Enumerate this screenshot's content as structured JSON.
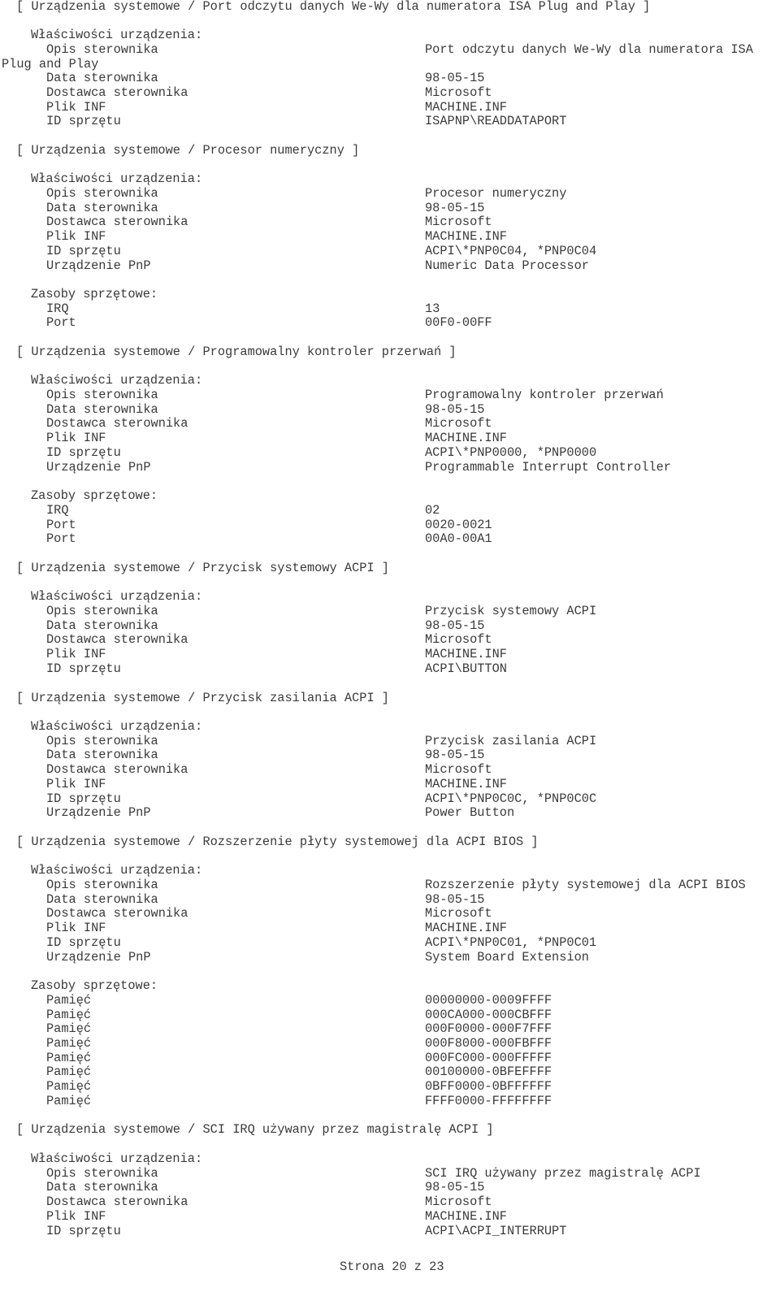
{
  "document": {
    "sections": [
      {
        "title": "[ Urządzenia systemowe / Port odczytu danych We-Wy dla numeratora ISA Plug and Play ]",
        "properties_heading": "Właściwości urządzenia:",
        "properties": [
          {
            "label": "Opis sterownika",
            "value": "Port odczytu danych We-Wy dla numeratora ISA",
            "continuation": "Plug and Play"
          },
          {
            "label": "Data sterownika",
            "value": "98-05-15"
          },
          {
            "label": "Dostawca sterownika",
            "value": "Microsoft"
          },
          {
            "label": "Plik INF",
            "value": "MACHINE.INF"
          },
          {
            "label": "ID sprzętu",
            "value": "ISAPNP\\READDATAPORT"
          }
        ]
      },
      {
        "title": "[ Urządzenia systemowe / Procesor numeryczny ]",
        "properties_heading": "Właściwości urządzenia:",
        "properties": [
          {
            "label": "Opis sterownika",
            "value": "Procesor numeryczny"
          },
          {
            "label": "Data sterownika",
            "value": "98-05-15"
          },
          {
            "label": "Dostawca sterownika",
            "value": "Microsoft"
          },
          {
            "label": "Plik INF",
            "value": "MACHINE.INF"
          },
          {
            "label": "ID sprzętu",
            "value": "ACPI\\*PNP0C04, *PNP0C04"
          },
          {
            "label": "Urządzenie PnP",
            "value": "Numeric Data Processor"
          }
        ],
        "resources_heading": "Zasoby sprzętowe:",
        "resources": [
          {
            "label": "IRQ",
            "value": "13"
          },
          {
            "label": "Port",
            "value": "00F0-00FF"
          }
        ]
      },
      {
        "title": "[ Urządzenia systemowe / Programowalny kontroler przerwań ]",
        "properties_heading": "Właściwości urządzenia:",
        "properties": [
          {
            "label": "Opis sterownika",
            "value": "Programowalny kontroler przerwań"
          },
          {
            "label": "Data sterownika",
            "value": "98-05-15"
          },
          {
            "label": "Dostawca sterownika",
            "value": "Microsoft"
          },
          {
            "label": "Plik INF",
            "value": "MACHINE.INF"
          },
          {
            "label": "ID sprzętu",
            "value": "ACPI\\*PNP0000, *PNP0000"
          },
          {
            "label": "Urządzenie PnP",
            "value": "Programmable Interrupt Controller"
          }
        ],
        "resources_heading": "Zasoby sprzętowe:",
        "resources": [
          {
            "label": "IRQ",
            "value": "02"
          },
          {
            "label": "Port",
            "value": "0020-0021"
          },
          {
            "label": "Port",
            "value": "00A0-00A1"
          }
        ]
      },
      {
        "title": "[ Urządzenia systemowe / Przycisk systemowy ACPI ]",
        "properties_heading": "Właściwości urządzenia:",
        "properties": [
          {
            "label": "Opis sterownika",
            "value": "Przycisk systemowy ACPI"
          },
          {
            "label": "Data sterownika",
            "value": "98-05-15"
          },
          {
            "label": "Dostawca sterownika",
            "value": "Microsoft"
          },
          {
            "label": "Plik INF",
            "value": "MACHINE.INF"
          },
          {
            "label": "ID sprzętu",
            "value": "ACPI\\BUTTON"
          }
        ]
      },
      {
        "title": "[ Urządzenia systemowe / Przycisk zasilania ACPI ]",
        "properties_heading": "Właściwości urządzenia:",
        "properties": [
          {
            "label": "Opis sterownika",
            "value": "Przycisk zasilania ACPI"
          },
          {
            "label": "Data sterownika",
            "value": "98-05-15"
          },
          {
            "label": "Dostawca sterownika",
            "value": "Microsoft"
          },
          {
            "label": "Plik INF",
            "value": "MACHINE.INF"
          },
          {
            "label": "ID sprzętu",
            "value": "ACPI\\*PNP0C0C, *PNP0C0C"
          },
          {
            "label": "Urządzenie PnP",
            "value": "Power Button"
          }
        ]
      },
      {
        "title": "[ Urządzenia systemowe / Rozszerzenie płyty systemowej dla ACPI BIOS ]",
        "properties_heading": "Właściwości urządzenia:",
        "properties": [
          {
            "label": "Opis sterownika",
            "value": "Rozszerzenie płyty systemowej dla ACPI BIOS"
          },
          {
            "label": "Data sterownika",
            "value": "98-05-15"
          },
          {
            "label": "Dostawca sterownika",
            "value": "Microsoft"
          },
          {
            "label": "Plik INF",
            "value": "MACHINE.INF"
          },
          {
            "label": "ID sprzętu",
            "value": "ACPI\\*PNP0C01, *PNP0C01"
          },
          {
            "label": "Urządzenie PnP",
            "value": "System Board Extension"
          }
        ],
        "resources_heading": "Zasoby sprzętowe:",
        "resources": [
          {
            "label": "Pamięć",
            "value": "00000000-0009FFFF"
          },
          {
            "label": "Pamięć",
            "value": "000CA000-000CBFFF"
          },
          {
            "label": "Pamięć",
            "value": "000F0000-000F7FFF"
          },
          {
            "label": "Pamięć",
            "value": "000F8000-000FBFFF"
          },
          {
            "label": "Pamięć",
            "value": "000FC000-000FFFFF"
          },
          {
            "label": "Pamięć",
            "value": "00100000-0BFEFFFF"
          },
          {
            "label": "Pamięć",
            "value": "0BFF0000-0BFFFFFF"
          },
          {
            "label": "Pamięć",
            "value": "FFFF0000-FFFFFFFF"
          }
        ]
      },
      {
        "title": "[ Urządzenia systemowe / SCI IRQ używany przez magistralę ACPI ]",
        "properties_heading": "Właściwości urządzenia:",
        "properties": [
          {
            "label": "Opis sterownika",
            "value": "SCI IRQ używany przez magistralę ACPI"
          },
          {
            "label": "Data sterownika",
            "value": "98-05-15"
          },
          {
            "label": "Dostawca sterownika",
            "value": "Microsoft"
          },
          {
            "label": "Plik INF",
            "value": "MACHINE.INF"
          },
          {
            "label": "ID sprzętu",
            "value": "ACPI\\ACPI_INTERRUPT"
          }
        ]
      }
    ],
    "footer": "Strona 20 z 23"
  }
}
